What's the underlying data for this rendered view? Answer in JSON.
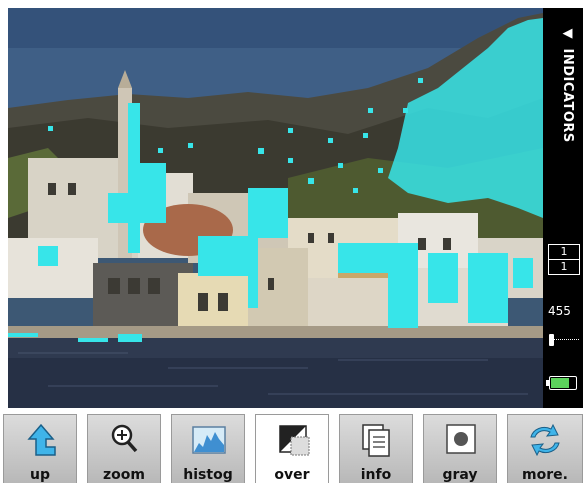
{
  "indicators": {
    "title": "INDICATORS",
    "frame_num": "1",
    "frame_den": "1",
    "count": "455",
    "slider_level": 0.05,
    "battery_level": 0.75,
    "battery_color": "#5cd35c"
  },
  "overlay_color": "#37e5e9",
  "toolbar": {
    "buttons": [
      {
        "id": "up",
        "label": "up",
        "icon": "up-arrow-icon"
      },
      {
        "id": "zoom",
        "label": "zoom",
        "icon": "magnifier-plus-icon"
      },
      {
        "id": "histog",
        "label": "histog",
        "icon": "histogram-icon"
      },
      {
        "id": "over",
        "label": "over",
        "icon": "overexposure-icon",
        "active": true
      },
      {
        "id": "info",
        "label": "info",
        "icon": "pages-info-icon"
      },
      {
        "id": "gray",
        "label": "gray",
        "icon": "gray-square-icon"
      },
      {
        "id": "more",
        "label": "more.",
        "icon": "cycle-arrows-icon"
      }
    ]
  }
}
